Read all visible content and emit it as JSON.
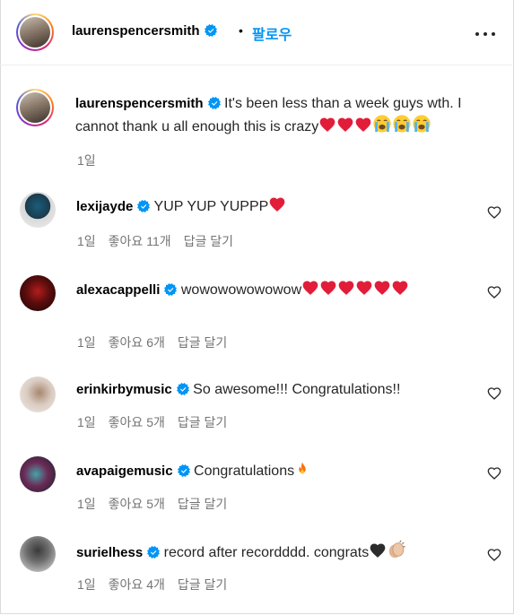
{
  "post": {
    "author": "laurenspencersmith",
    "separator": "•",
    "follow_label": "팔로우",
    "caption_text": "It's been less than a week guys wth. I cannot thank u all enough this is crazy",
    "caption_emojis": [
      "red-heart",
      "red-heart",
      "red-heart",
      "crying-face",
      "crying-face",
      "crying-face"
    ],
    "caption_time": "1일"
  },
  "comments": [
    {
      "user": "lexijayde",
      "text": "YUP YUP YUPPP",
      "emojis": [
        "red-heart"
      ],
      "time": "1일",
      "likes": "좋아요 11개",
      "reply": "답글 달기"
    },
    {
      "user": "alexacappelli",
      "text": "wowowowowowow",
      "emojis": [
        "red-heart",
        "red-heart",
        "red-heart",
        "red-heart",
        "red-heart",
        "red-heart"
      ],
      "time": "1일",
      "likes": "좋아요 6개",
      "reply": "답글 달기"
    },
    {
      "user": "erinkirbymusic",
      "text": "So awesome!!! Congratulations!!",
      "emojis": [],
      "time": "1일",
      "likes": "좋아요 5개",
      "reply": "답글 달기"
    },
    {
      "user": "avapaigemusic",
      "text": "Congratulations",
      "emojis": [
        "fire"
      ],
      "time": "1일",
      "likes": "좋아요 5개",
      "reply": "답글 달기"
    },
    {
      "user": "surielhess",
      "text": "record after recordddd. congrats",
      "emojis": [
        "black-heart",
        "clapping-hands"
      ],
      "time": "1일",
      "likes": "좋아요 4개",
      "reply": "답글 달기"
    }
  ],
  "colors": {
    "accent": "#0095f6",
    "verified": "#0095f6",
    "heart": "#ed1c3a",
    "meta": "#737373"
  }
}
